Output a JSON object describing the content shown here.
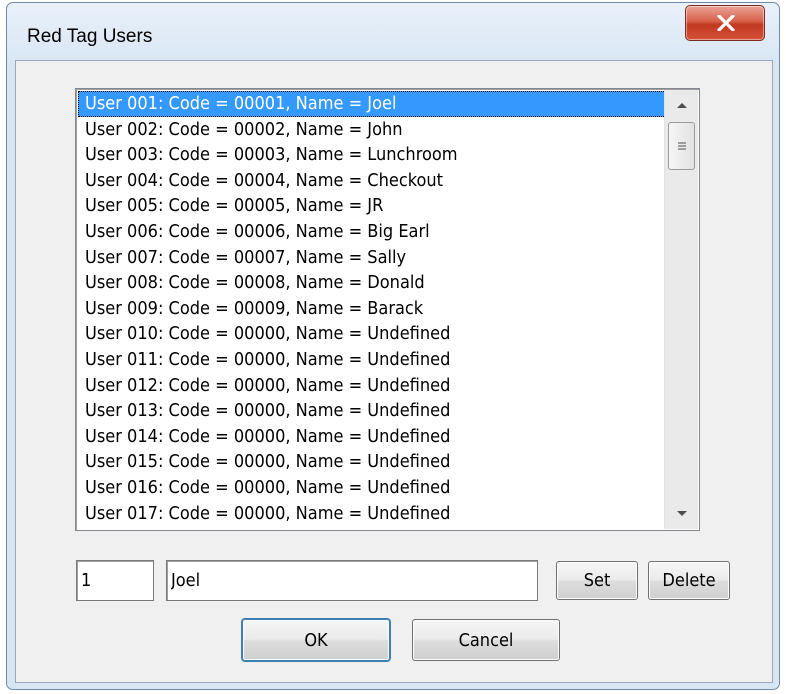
{
  "window": {
    "title": "Red Tag Users",
    "close_label": "X"
  },
  "user_list": {
    "selected_index": 0,
    "items": [
      "User 001:  Code = 00001, Name = Joel",
      "User 002:  Code = 00002, Name = John",
      "User 003:  Code = 00003, Name = Lunchroom",
      "User 004:  Code = 00004, Name = Checkout",
      "User 005:  Code = 00005, Name = JR",
      "User 006:  Code = 00006, Name = Big Earl",
      "User 007:  Code = 00007, Name = Sally",
      "User 008:  Code = 00008, Name = Donald",
      "User 009:  Code = 00009, Name = Barack",
      "User 010:  Code = 00000, Name = Undefined",
      "User 011:  Code = 00000, Name = Undefined",
      "User 012:  Code = 00000, Name = Undefined",
      "User 013:  Code = 00000, Name = Undefined",
      "User 014:  Code = 00000, Name = Undefined",
      "User 015:  Code = 00000, Name = Undefined",
      "User 016:  Code = 00000, Name = Undefined",
      "User 017:  Code = 00000, Name = Undefined"
    ]
  },
  "editor": {
    "code_value": "1",
    "name_value": "Joel",
    "set_label": "Set",
    "delete_label": "Delete"
  },
  "footer": {
    "ok_label": "OK",
    "cancel_label": "Cancel"
  },
  "icons": {
    "close": "close-icon",
    "scroll_up": "chevron-up-icon",
    "scroll_down": "chevron-down-icon",
    "scroll_grip": "grip-icon"
  },
  "colors": {
    "selection": "#3399ff",
    "close_button": "#c9452c"
  }
}
